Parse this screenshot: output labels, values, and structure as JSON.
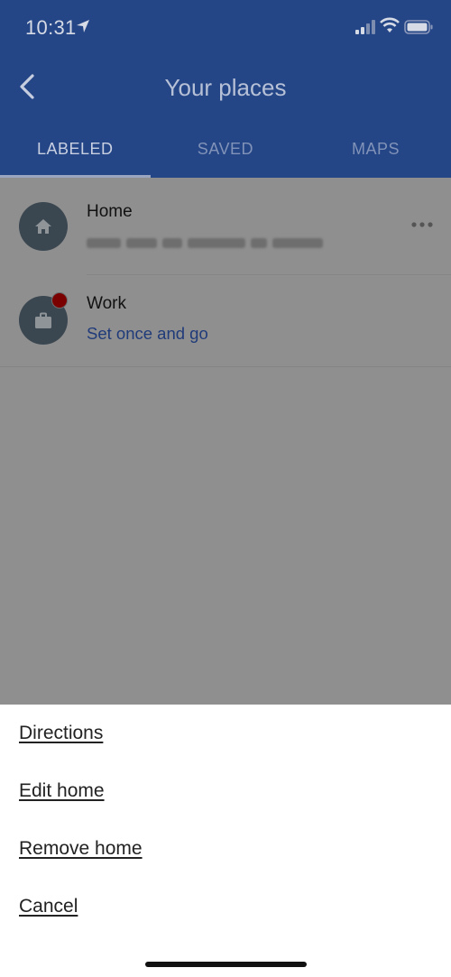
{
  "status_bar": {
    "time": "10:31",
    "icons": [
      "location-arrow-icon",
      "cellular-signal-icon",
      "wifi-icon",
      "battery-icon"
    ]
  },
  "header": {
    "title": "Your places",
    "back_icon": "back-chevron-icon"
  },
  "tabs": [
    {
      "label": "LABELED",
      "active": true
    },
    {
      "label": "SAVED",
      "active": false
    },
    {
      "label": "MAPS",
      "active": false
    }
  ],
  "places": [
    {
      "label": "Home",
      "icon": "home-icon",
      "address": ""
    },
    {
      "label": "Work",
      "icon": "briefcase-icon",
      "hint": "Set once and go"
    }
  ],
  "action_sheet": {
    "items": [
      "Directions",
      "Edit home",
      "Remove home",
      "Cancel"
    ]
  },
  "colors": {
    "header_bg": "#244586",
    "link_blue": "#203b7a",
    "overlay_gray": "#8f8f8f",
    "badge_red": "#7a0000"
  }
}
